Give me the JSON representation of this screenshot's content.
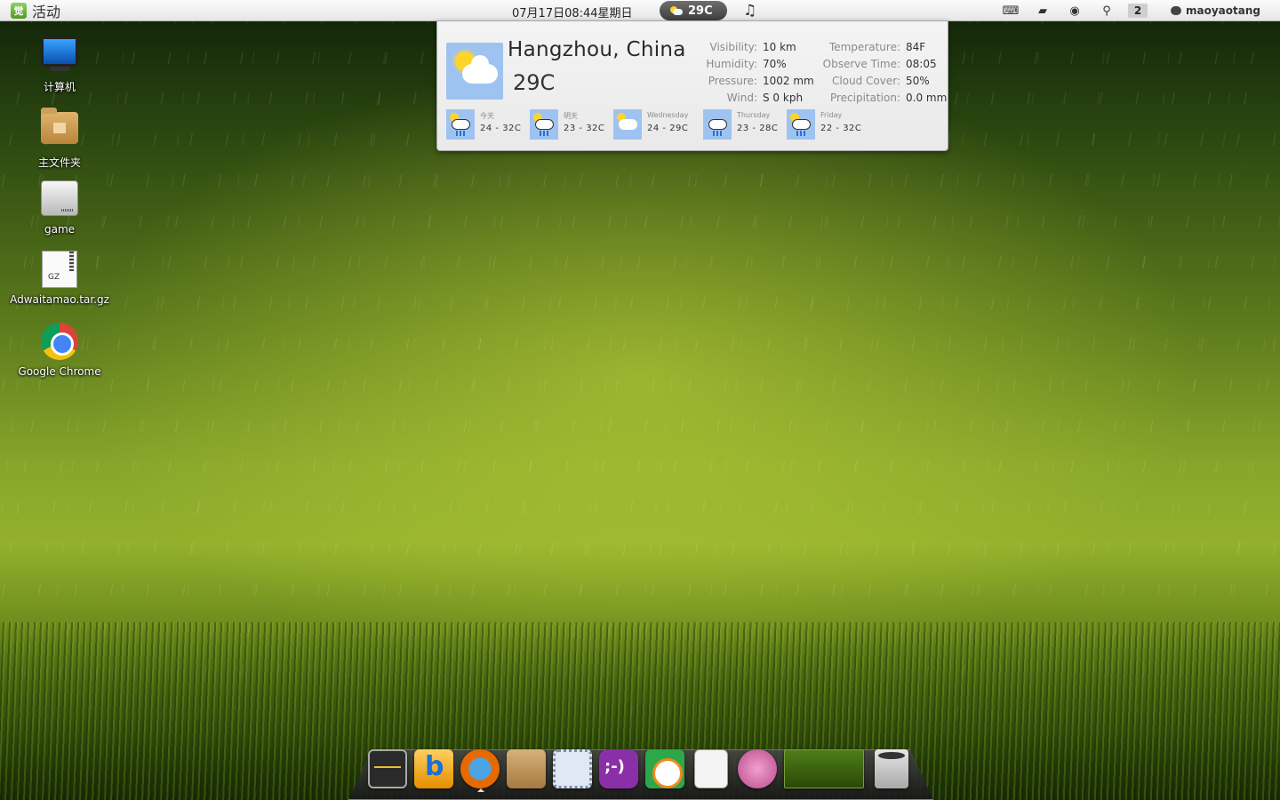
{
  "top_panel": {
    "logo_glyph": "觉",
    "activities_label": "活动",
    "clock": "07月17日08:44星期日",
    "weather_temp": "29C",
    "music_icon": "music-note-icon",
    "tray_icons": [
      "keyboard-icon",
      "folder-icon",
      "record-icon",
      "network-icon"
    ],
    "workspace_number": "2",
    "username": "maoyaotang"
  },
  "desktop_icons": [
    {
      "label": "计算机",
      "icon": "computer-icon"
    },
    {
      "label": "主文件夹",
      "icon": "home-folder-icon"
    },
    {
      "label": "game",
      "icon": "drive-icon"
    },
    {
      "label": "Adwaitamao.tar.gz",
      "icon": "archive-icon",
      "badge": "GZ"
    },
    {
      "label": "Google Chrome",
      "icon": "chrome-icon"
    }
  ],
  "weather": {
    "city": "Hangzhou, China",
    "current_temp": "29C",
    "details_left": [
      {
        "key": "Visibility:",
        "value": "10 km"
      },
      {
        "key": "Humidity:",
        "value": "70%"
      },
      {
        "key": "Pressure:",
        "value": "1002 mm"
      },
      {
        "key": "Wind:",
        "value": "S 0 kph"
      }
    ],
    "details_right": [
      {
        "key": "Temperature:",
        "value": "84F"
      },
      {
        "key": "Observe Time:",
        "value": "08:05"
      },
      {
        "key": "Cloud Cover:",
        "value": "50%"
      },
      {
        "key": "Precipitation:",
        "value": "0.0 mm"
      }
    ],
    "forecast": [
      {
        "day": "今天",
        "range": "24 - 32C",
        "icon": "sun-rain-cloud-icon"
      },
      {
        "day": "明天",
        "range": "23 - 32C",
        "icon": "sun-rain-cloud-icon"
      },
      {
        "day": "Wednesday",
        "range": "24 - 29C",
        "icon": "partly-cloudy-icon"
      },
      {
        "day": "Thursday",
        "range": "23 - 28C",
        "icon": "rain-cloud-icon"
      },
      {
        "day": "Friday",
        "range": "22 - 32C",
        "icon": "sun-rain-cloud-icon"
      }
    ]
  },
  "dock": {
    "items": [
      "system-monitor-icon",
      "bing-icon",
      "firefox-icon",
      "package-icon",
      "stamp-icon",
      "chat-icon",
      "qq-icon",
      "document-icon",
      "music-player-icon",
      "workspace-switcher",
      "trash-icon"
    ]
  }
}
